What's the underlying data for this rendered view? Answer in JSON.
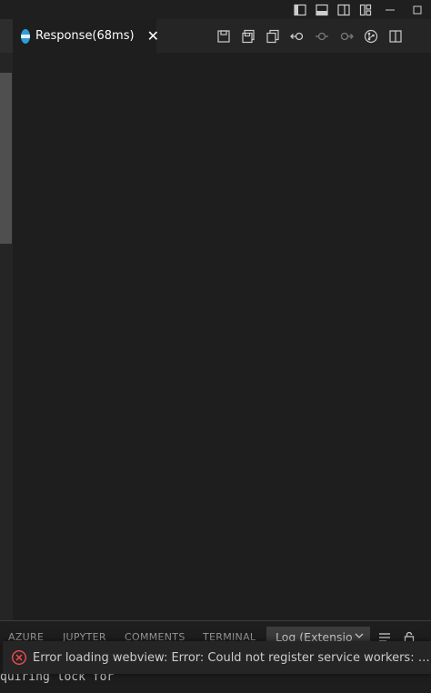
{
  "colors": {
    "accent": "#2b9fd9",
    "error": "#f14c4c",
    "editor_bg": "#1e1e1e"
  },
  "titlebar": {
    "icons": [
      "toggle-primary-sidebar-icon",
      "toggle-panel-icon",
      "toggle-secondary-sidebar-icon",
      "customize-layout-icon",
      "minimize-icon",
      "maximize-icon"
    ]
  },
  "tab": {
    "label": "Response(68ms)",
    "close": "✕",
    "icon": "rest-client-icon"
  },
  "toolbar": {
    "icons": [
      "save-response-icon",
      "save-body-icon",
      "copy-icon",
      "go-back-icon",
      "git-commit-icon",
      "go-forward-icon",
      "gitlens-icon",
      "split-editor-icon"
    ]
  },
  "panel": {
    "tabs": [
      "AZURE",
      "JUPYTER",
      "COMMENTS",
      "TERMINAL"
    ],
    "log_select": "Log (Extensio",
    "terminal_text": "quiring lock for"
  },
  "notification": {
    "message": "Error loading webview: Error: Could not register service workers: Invali..."
  }
}
